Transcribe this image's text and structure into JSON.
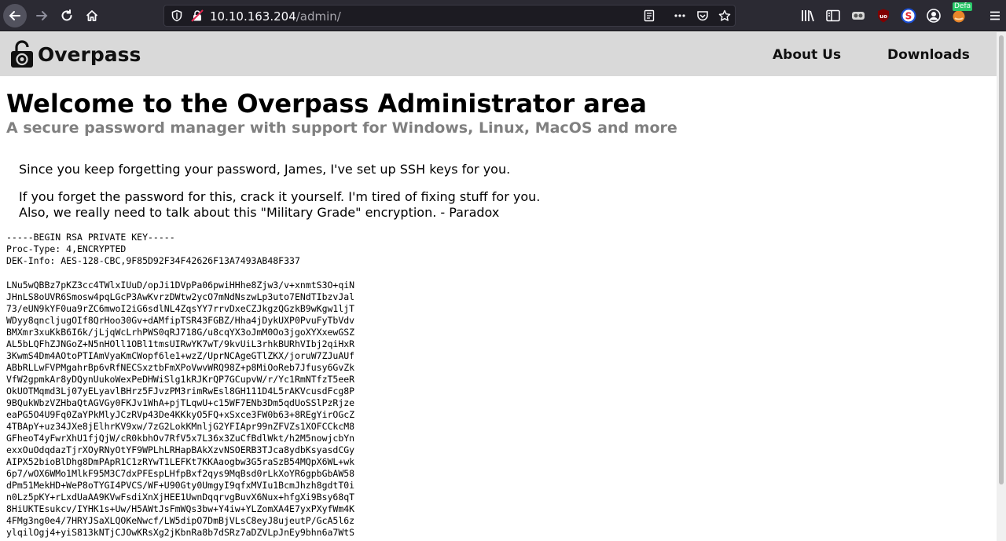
{
  "browser": {
    "url_host": "10.10.163.204",
    "url_path": "/admin/",
    "badge": "Defa",
    "icons": [
      "back-icon",
      "forward-icon",
      "reload-icon",
      "home-icon",
      "shield-icon",
      "insecure-lock-icon",
      "reader-icon",
      "more-icon",
      "pocket-icon",
      "star-icon",
      "library-icon",
      "sidebar-icon",
      "extension-icon",
      "ublock-icon",
      "extension-s-icon",
      "account-icon",
      "foxyproxy-icon",
      "menu-icon"
    ]
  },
  "site": {
    "brand": "Overpass",
    "nav": {
      "about": "About Us",
      "downloads": "Downloads"
    }
  },
  "main": {
    "title": "Welcome to the Overpass Administrator area",
    "subtitle": "A secure password manager with support for Windows, Linux, MacOS and more",
    "message_1": "Since you keep forgetting your password, James, I've set up SSH keys for you.",
    "message_2": "If you forget the password for this, crack it yourself. I'm tired of fixing stuff for you.",
    "message_3": "Also, we really need to talk about this \"Military Grade\" encryption. - Paradox"
  },
  "key": {
    "header": [
      "-----BEGIN RSA PRIVATE KEY-----",
      "Proc-Type: 4,ENCRYPTED",
      "DEK-Info: AES-128-CBC,9F85D92F34F42626F13A7493AB48F337"
    ],
    "body": [
      "LNu5wQBBz7pKZ3cc4TWlxIUuD/opJi1DVpPa06pwiHHhe8Zjw3/v+xnmtS3O+qiN",
      "JHnLS8oUVR6Smosw4pqLGcP3AwKvrzDWtw2ycO7mNdNszwLp3uto7ENdTIbzvJal",
      "73/eUN9kYF0ua9rZC6mwoI2iG6sdlNL4ZqsYY7rrvDxeCZJkgzQGzkB9wKgw1ljT",
      "WDyy8qncljugOIf8QrHoo30Gv+dAMfipTSR43FGBZ/Hha4jDykUXP0PvuFyTbVdv",
      "BMXmr3xuKkB6I6k/jLjqWcLrhPWS0qRJ718G/u8cqYX3oJmM0Oo3jgoXYXxewGSZ",
      "AL5bLQFhZJNGoZ+N5nHOll1OBl1tmsUIRwYK7wT/9kvUiL3rhkBURhVIbj2qiHxR",
      "3KwmS4Dm4AOtoPTIAmVyaKmCWopf6le1+wzZ/UprNCAgeGTlZKX/joruW7ZJuAUf",
      "ABbRLLwFVPMgahrBp6vRfNECSxztbFmXPoVwvWRQ98Z+p8MiOoReb7Jfusy6GvZk",
      "VfW2gpmkAr8yDQynUukoWexPeDHWiSlg1kRJKrQP7GCupvW/r/Yc1RmNTfzT5eeR",
      "OkUOTMqmd3Lj07yELyavlBHrz5FJvzPM3rimRwEsl8GH111D4L5rAKVcusdFcg8P",
      "9BQukWbzVZHbaQtAGVGy0FKJv1WhA+pjTLqwU+c15WF7ENb3Dm5qdUoSSlPzRjze",
      "eaPG5O4U9Fq0ZaYPkMlyJCzRVp43De4KKkyO5FQ+xSxce3FW0b63+8REgYirOGcZ",
      "4TBApY+uz34JXe8jElhrKV9xw/7zG2LokKMnljG2YFIApr99nZFVZs1XOFCCkcM8",
      "GFheoT4yFwrXhU1fjQjW/cR0kbhOv7RfV5x7L36x3ZuCfBdlWkt/h2M5nowjcbYn",
      "exxOuOdqdazTjrXOyRNyOtYF9WPLhLRHapBAkXzvNSOERB3TJca8ydbKsyasdCGy",
      "AIPX52bioBlDhg8DmPApR1C1zRYwT1LEFKt7KKAaogbw3G5raSzB54MQpX6WL+wk",
      "6p7/wOX6WMo1MlkF95M3C7dxPFEspLHfpBxf2qys9MqBsd0rLkXoYR6gpbGbAW58",
      "dPm51MekHD+WeP8oTYGI4PVCS/WF+U90Gty0UmgyI9qfxMVIu1BcmJhzh8gdtT0i",
      "n0Lz5pKY+rLxdUaAA9KVwFsdiXnXjHEE1UwnDqqrvgBuvX6Nux+hfgXi9Bsy68qT",
      "8HiUKTEsukcv/IYHK1s+Uw/H5AWtJsFmWQs3bw+Y4iw+YLZomXA4E7yxPXyfWm4K",
      "4FMg3ng0e4/7HRYJSaXLQOKeNwcf/LW5dipO7DmBjVLsC8eyJ8ujeutP/GcA5l6z",
      "ylqilOgj4+yiS813kNTjCJOwKRsXg2jKbnRa8b7dSRz7aDZVLpJnEy9bhn6a7WtS"
    ]
  }
}
